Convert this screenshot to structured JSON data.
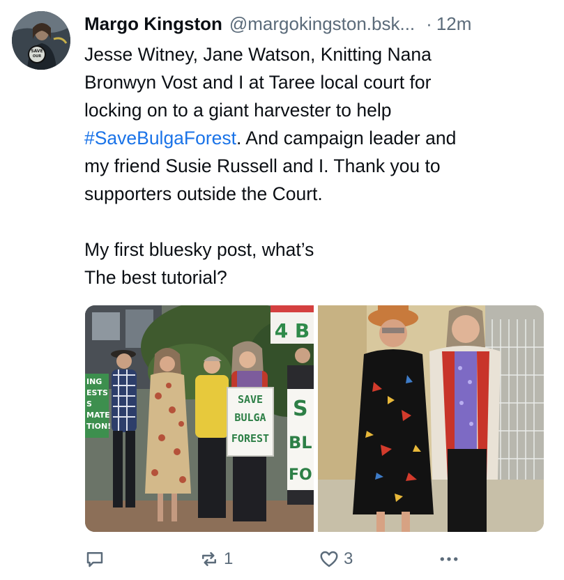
{
  "post": {
    "author": {
      "display_name": "Margo Kingston",
      "handle": "@margokingston.bsk...",
      "avatar_icon": "avatar-photo"
    },
    "separator": "·",
    "timestamp": "12m",
    "text_lines": [
      {
        "text": "Jesse Witney, Jane Watson, Knitting Nana"
      },
      {
        "text": "Bronwyn Vost and I at Taree local court for"
      },
      {
        "text": "locking on to a giant harvester to help"
      },
      {
        "hashtag": "#SaveBulgaForest",
        "text": ". And campaign leader and"
      },
      {
        "text": "my friend Susie Russell and I. Thank you to"
      },
      {
        "text": "supporters outside the Court."
      },
      {
        "text": ""
      },
      {
        "text": "My first bluesky post, what’s"
      },
      {
        "text": "The best tutorial?"
      }
    ],
    "images": [
      {
        "sign_lines": [
          "SAVE",
          "BULGA",
          "FOREST"
        ],
        "banner_left_lines": [
          "ING",
          "ESTS",
          "S",
          "MATE",
          "TION!"
        ],
        "banner_right_lines": [
          "S",
          "BL",
          "FO"
        ],
        "top_sign_text": "4 B"
      },
      {}
    ],
    "actions": {
      "reply_icon": "comment-icon",
      "repost_icon": "repost-icon",
      "repost_count": "1",
      "like_icon": "heart-icon",
      "like_count": "3",
      "more_icon": "more-icon"
    }
  },
  "colors": {
    "text": "#0b0f14",
    "muted": "#5b6b7a",
    "link": "#1a73e8",
    "background": "#ffffff"
  }
}
